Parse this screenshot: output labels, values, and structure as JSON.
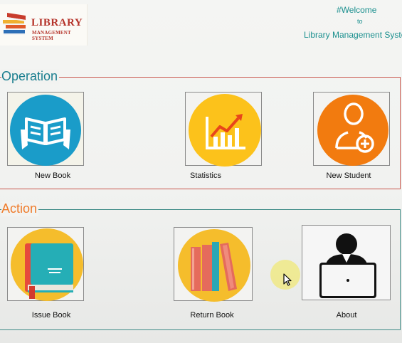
{
  "logo": {
    "line1": "LIBRARY",
    "line2": "MANAGEMENT SYSTEM",
    "icon": "books-stack-icon"
  },
  "welcome": {
    "line1": "#Welcome",
    "line2": "to",
    "line3": "Library Management System"
  },
  "operation": {
    "title": "Operation",
    "buttons": [
      {
        "label": "New Book",
        "icon": "open-book-icon"
      },
      {
        "label": "Statistics",
        "icon": "chart-icon"
      },
      {
        "label": "New Student",
        "icon": "add-user-icon"
      }
    ]
  },
  "action": {
    "title": "Action",
    "buttons": [
      {
        "label": "Issue Book",
        "icon": "book-icon"
      },
      {
        "label": "Return Book",
        "icon": "books-icon"
      },
      {
        "label": "About",
        "icon": "user-laptop-icon"
      }
    ]
  },
  "colors": {
    "operation_border": "#c9564c",
    "action_border": "#3e8b86",
    "operation_title": "#1a7e8f",
    "action_title": "#ef7b2a",
    "welcome_text": "#1a8f8e"
  }
}
